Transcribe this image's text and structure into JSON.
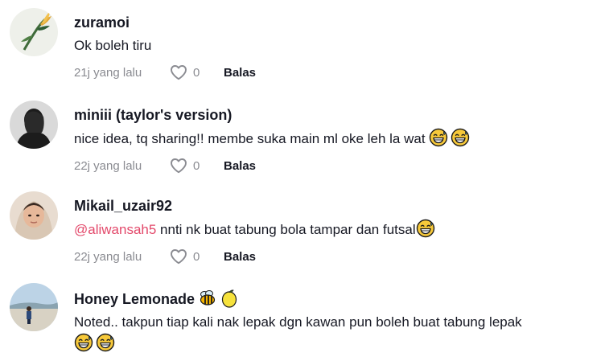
{
  "comments": [
    {
      "username": "zuramoi",
      "text": "Ok boleh tiru",
      "time": "21j yang lalu",
      "likes": "0",
      "reply_label": "Balas"
    },
    {
      "username": "miniii (taylor's version)",
      "text": "nice idea, tq sharing!! membe suka main ml oke leh la wat",
      "time": "22j yang lalu",
      "likes": "0",
      "reply_label": "Balas"
    },
    {
      "username": "Mikail_uzair92",
      "mention": "@aliwansah5",
      "text": " nnti nk buat tabung bola tampar dan futsal",
      "time": "22j yang lalu",
      "likes": "0",
      "reply_label": "Balas"
    },
    {
      "username": "Honey Lemonade",
      "text": "Noted.. takpun tiap kali nak lepak dgn kawan pun boleh buat tabung lepak"
    }
  ],
  "icons": {
    "like": "heart-outline-icon",
    "emoji": "grinning-sweat-face-emoji",
    "bee": "bee-emoji",
    "lemon": "lemon-emoji"
  },
  "colors": {
    "mention": "#e3486a",
    "meta": "#8a8b91",
    "text": "#161823"
  }
}
